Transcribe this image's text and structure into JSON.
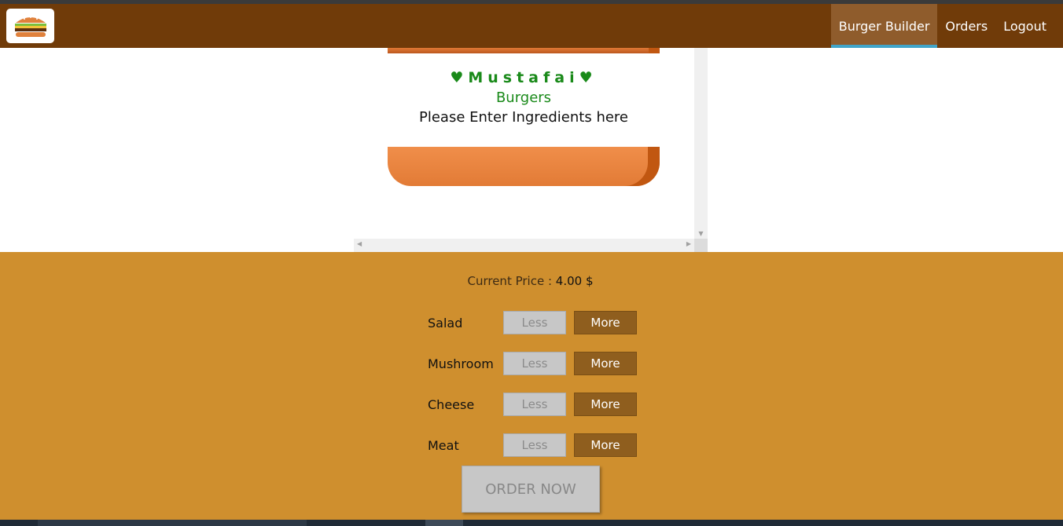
{
  "toolbar": {
    "logo_icon": "burger-logo-icon",
    "nav": [
      {
        "label": "Burger Builder",
        "active": true
      },
      {
        "label": "Orders",
        "active": false
      },
      {
        "label": "Logout",
        "active": false
      }
    ]
  },
  "burger": {
    "brand_name": "♥Mustafai♥",
    "brand_sub": "Burgers",
    "placeholder": "Please Enter Ingredients here"
  },
  "controls": {
    "price_label": "Current Price :",
    "price_value": "4.00 $",
    "ingredients": [
      {
        "label": "Salad",
        "less": "Less",
        "more": "More"
      },
      {
        "label": "Mushroom",
        "less": "Less",
        "more": "More"
      },
      {
        "label": "Cheese",
        "less": "Less",
        "more": "More"
      },
      {
        "label": "Meat",
        "less": "Less",
        "more": "More"
      }
    ],
    "order_label": "ORDER NOW"
  },
  "colors": {
    "toolbar": "#703b09",
    "active_nav": "#8f5c2c",
    "active_underline": "#40a4c8",
    "controls_bg": "#cf8f2e",
    "more_button": "#8f5e1e",
    "disabled_button": "#c7c7c7",
    "brand_text": "#1a8a1a"
  }
}
